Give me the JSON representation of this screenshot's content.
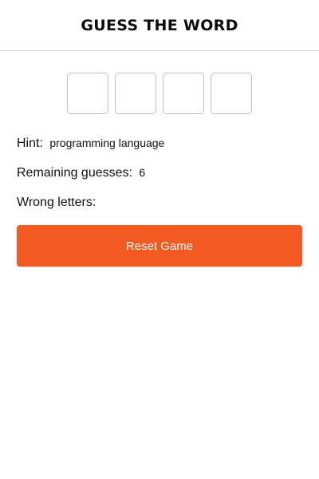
{
  "header": {
    "title": "GUESS THE WORD"
  },
  "word": {
    "slots": [
      "",
      "",
      "",
      ""
    ]
  },
  "hint": {
    "label": "Hint:",
    "value": "programming language"
  },
  "remaining": {
    "label": "Remaining guesses:",
    "value": "6"
  },
  "wrong": {
    "label": "Wrong letters:",
    "value": ""
  },
  "actions": {
    "reset_label": "Reset Game"
  },
  "colors": {
    "accent": "#f35a22",
    "slot_border": "#bdbdbd",
    "divider": "#d9d9d9"
  }
}
